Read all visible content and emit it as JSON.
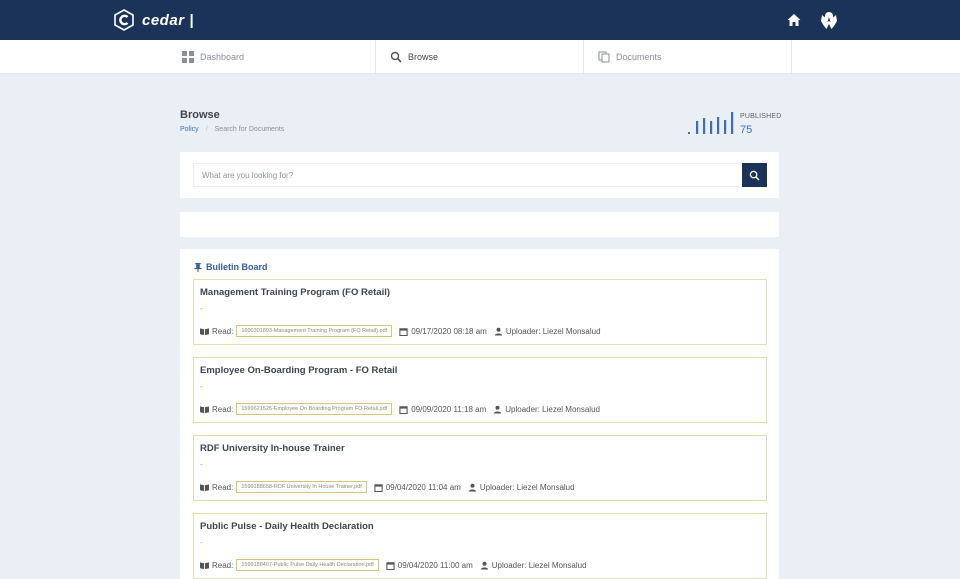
{
  "header": {
    "app_name": "cedar |",
    "home_icon": "home-icon",
    "user_icon": "user-avatar-icon",
    "bg_color": "#1b3358"
  },
  "nav": {
    "tabs": [
      {
        "label": "Dashboard",
        "icon": "dashboard-icon"
      },
      {
        "label": "Browse",
        "icon": "search-icon",
        "active": true
      },
      {
        "label": "Documents",
        "icon": "documents-icon"
      }
    ]
  },
  "page": {
    "title": "Browse",
    "breadcrumb": [
      "Policy",
      "Search for Documents"
    ]
  },
  "stat": {
    "label": "PUBLISHED",
    "value": "75",
    "color": "#3a6cc4"
  },
  "search": {
    "placeholder": "What are you looking for?",
    "value": ""
  },
  "bulletin": {
    "title": "Bulletin Board",
    "read_label": "Read:",
    "uploader_prefix": "Uploader:",
    "posts": [
      {
        "title": "Management Training Program (FO Retail)",
        "description": "-",
        "file": "1600301893-Management Training Program (FO Retail).pdf",
        "date": "09/17/2020 08:18 am",
        "uploader": "Liezel Monsalud"
      },
      {
        "title": "Employee On-Boarding Program - FO Retail",
        "description": "-",
        "file": "1599621525-Employee On Boarding Program FO Retail.pdf",
        "date": "09/09/2020 11:18 am",
        "uploader": "Liezel Monsalud"
      },
      {
        "title": "RDF University In-house Trainer",
        "description": "-",
        "file": "1599188658-RDF University In House Trainer.pdf",
        "date": "09/04/2020 11:04 am",
        "uploader": "Liezel Monsalud"
      },
      {
        "title": "Public Pulse - Daily Health Declaration",
        "description": "-",
        "file": "1599188407-Public Pulse Daily Health Declaration.pdf",
        "date": "09/04/2020 11:00 am",
        "uploader": "Liezel Monsalud"
      }
    ]
  }
}
